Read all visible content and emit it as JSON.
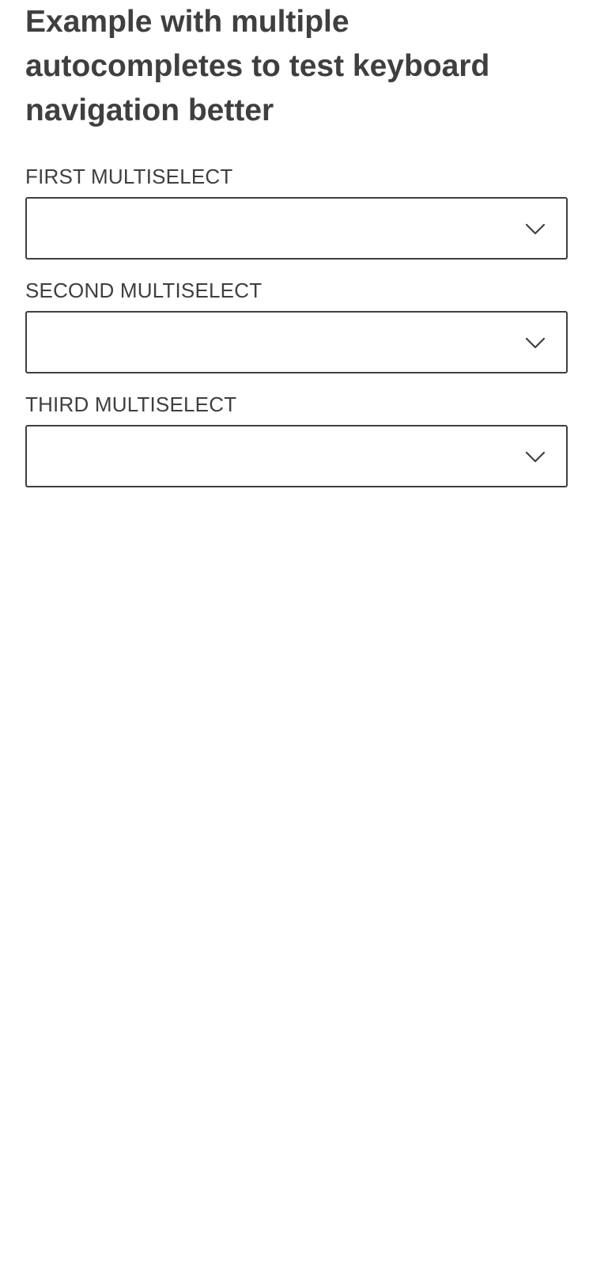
{
  "page": {
    "title": "Example with multiple autocompletes to test keyboard navigation better"
  },
  "fields": [
    {
      "label": "FIRST MULTISELECT",
      "value": "",
      "icon": "chevron-down-icon"
    },
    {
      "label": "SECOND MULTISELECT",
      "value": "",
      "icon": "chevron-down-icon"
    },
    {
      "label": "THIRD MULTISELECT",
      "value": "",
      "icon": "chevron-down-icon"
    }
  ],
  "colors": {
    "text": "#3f3f3f",
    "border": "#3f3f3f",
    "background": "#ffffff"
  }
}
